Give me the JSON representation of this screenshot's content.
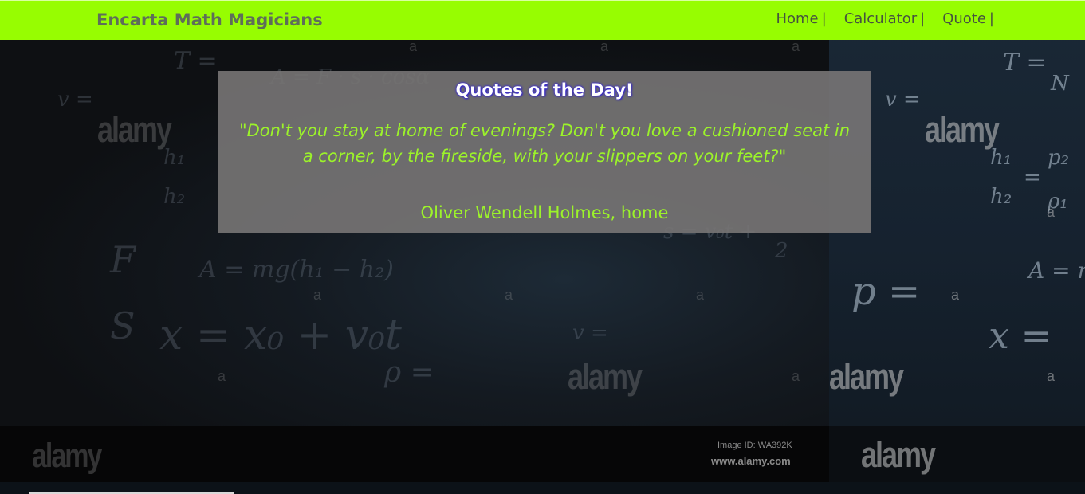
{
  "navbar": {
    "brand": "Encarta Math Magicians",
    "links": [
      {
        "label": "Home",
        "separator": "|"
      },
      {
        "label": "Calculator",
        "separator": "|"
      },
      {
        "label": "Quote",
        "separator": "|"
      }
    ],
    "background_color": "#97fd01"
  },
  "quote_card": {
    "heading": "Quotes of the Day!",
    "text": "\"Don't you stay at home of evenings? Don't you love a cushioned seat in a corner, by the fireside, with your slippers on your feet?\"",
    "author": "Oliver Wendell Holmes, home",
    "text_color": "#9cf32a"
  },
  "background": {
    "watermark": "alamy",
    "watermark_letter": "a",
    "image_id": "Image ID: WA392K",
    "url": "www.alamy.com",
    "formulas": [
      "T =",
      "v =",
      "A = F · s · cosα",
      "h₁",
      "h₂",
      "A = mg(h₁ − h₂)",
      "x = x₀ + v₀t",
      "ρ =",
      "v =",
      "s = v₀t +",
      "2",
      "F",
      "S",
      "p =",
      "T =",
      "N",
      "v =",
      "h₁",
      "h₂",
      "=",
      "p₂",
      "ρ₁",
      "A = m",
      "x ="
    ]
  }
}
